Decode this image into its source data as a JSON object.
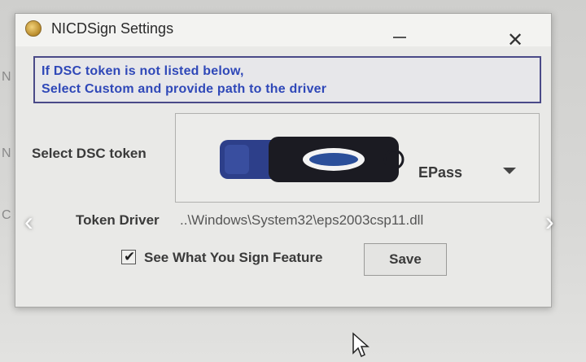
{
  "window": {
    "title": "NICDSign Settings",
    "close_glyph": "✕"
  },
  "info": {
    "line1": "If DSC token is not listed below,",
    "line2": "Select Custom and provide path to the driver"
  },
  "token_select": {
    "label": "Select DSC token",
    "selected_value": "EPass",
    "token_icon": "usb-token-icon"
  },
  "driver": {
    "label": "Token Driver",
    "path": "..\\Windows\\System32\\eps2003csp11.dll"
  },
  "feature": {
    "checked": true,
    "check_glyph": "✔",
    "label": "See What You Sign Feature"
  },
  "save": {
    "label": "Save"
  },
  "nav": {
    "left_glyph": "‹",
    "right_glyph": "›"
  },
  "background_letters": [
    "N",
    "N",
    "C"
  ],
  "colors": {
    "info_text": "#2f48b8",
    "info_border": "#4a4a88",
    "window_bg": "#e9e9e7"
  }
}
